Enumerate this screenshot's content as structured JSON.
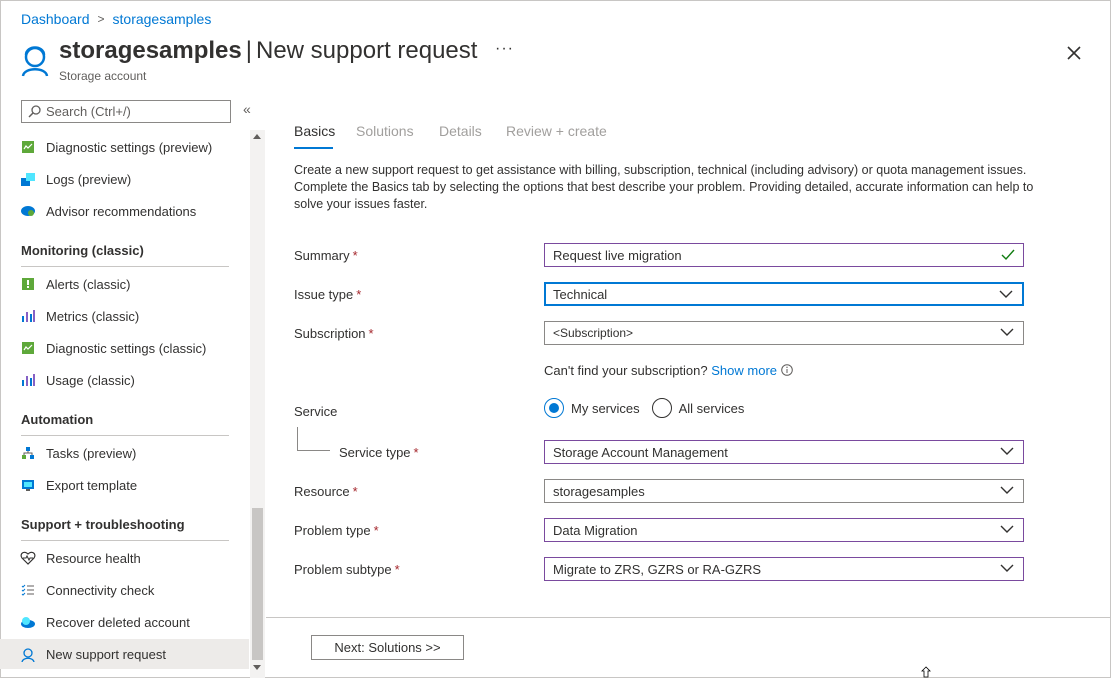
{
  "breadcrumb": {
    "items": [
      "Dashboard",
      "storagesamples"
    ],
    "separator": ">"
  },
  "header": {
    "resource_name": "storagesamples",
    "pipe": "|",
    "page_title": "New support request",
    "subtitle": "Storage account",
    "more_label": "···",
    "icon": "support-person-icon"
  },
  "sidebar": {
    "search_placeholder": "Search (Ctrl+/)",
    "collapse_label": "«",
    "items_top": [
      {
        "label": "Diagnostic settings (preview)",
        "icon": "diagnostic-settings-icon"
      },
      {
        "label": "Logs (preview)",
        "icon": "logs-icon"
      },
      {
        "label": "Advisor recommendations",
        "icon": "advisor-icon"
      }
    ],
    "sections": [
      {
        "title": "Monitoring (classic)",
        "items": [
          {
            "label": "Alerts (classic)",
            "icon": "alerts-icon"
          },
          {
            "label": "Metrics (classic)",
            "icon": "metrics-icon"
          },
          {
            "label": "Diagnostic settings (classic)",
            "icon": "diagnostic-settings-icon"
          },
          {
            "label": "Usage (classic)",
            "icon": "usage-icon"
          }
        ]
      },
      {
        "title": "Automation",
        "items": [
          {
            "label": "Tasks (preview)",
            "icon": "tasks-icon"
          },
          {
            "label": "Export template",
            "icon": "export-template-icon"
          }
        ]
      },
      {
        "title": "Support + troubleshooting",
        "items": [
          {
            "label": "Resource health",
            "icon": "heart-icon"
          },
          {
            "label": "Connectivity check",
            "icon": "checklist-icon"
          },
          {
            "label": "Recover deleted account",
            "icon": "cloud-recover-icon"
          },
          {
            "label": "New support request",
            "icon": "support-person-icon",
            "selected": true
          }
        ]
      }
    ]
  },
  "tabs": [
    "Basics",
    "Solutions",
    "Details",
    "Review + create"
  ],
  "active_tab": "Basics",
  "intro": {
    "line1": "Create a new support request to get assistance with billing, subscription, technical (including advisory) or quota management issues.",
    "line2": "Complete the Basics tab by selecting the options that best describe your problem. Providing detailed, accurate information can help to solve your issues faster."
  },
  "form": {
    "required_mark": "*",
    "summary": {
      "label": "Summary",
      "value": "Request live migration"
    },
    "issue_type": {
      "label": "Issue type",
      "value": "Technical"
    },
    "subscription": {
      "label": "Subscription",
      "value": "<Subscription>"
    },
    "cant_find_text": "Can't find your subscription?",
    "show_more_link": "Show more",
    "service": {
      "label": "Service",
      "options": [
        "My services",
        "All services"
      ],
      "selected": "My services"
    },
    "service_type": {
      "label": "Service type",
      "value": "Storage Account Management"
    },
    "resource": {
      "label": "Resource",
      "value": "storagesamples"
    },
    "problem_type": {
      "label": "Problem type",
      "value": "Data Migration"
    },
    "problem_subtype": {
      "label": "Problem subtype",
      "value": "Migrate to ZRS, GZRS or RA-GZRS"
    }
  },
  "footer": {
    "next_label": "Next: Solutions >>"
  },
  "colors": {
    "accent": "#0078d4",
    "required": "#a4262c",
    "valid_check": "#107c10",
    "field_border_purple": "#7a4a9e"
  }
}
